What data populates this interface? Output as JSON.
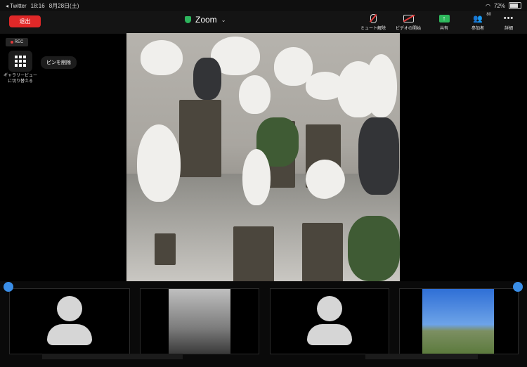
{
  "status_bar": {
    "back_app": "◂ Twitter",
    "time": "18:16",
    "date": "8月28日(土)",
    "battery": "72%"
  },
  "toolbar": {
    "leave_label": "退出",
    "title": "Zoom",
    "mute_label": "ミュート解除",
    "video_label": "ビデオの開始",
    "share_label": "共有",
    "participants_label": "参加者",
    "participants_count": "80",
    "more_label": "詳細"
  },
  "overlay": {
    "rec_label": "REC",
    "gallery_label": "ギャラリービューに切り替える",
    "unpin_label": "ピンを削除"
  },
  "icons": {
    "shield": "shield-icon",
    "mic_off": "mic-off-icon",
    "video_off": "video-off-icon",
    "share": "share-screen-icon",
    "participants": "participants-icon",
    "more": "more-dots-icon",
    "gallery": "grid-icon",
    "avatar": "avatar-icon"
  },
  "colors": {
    "leave": "#e02828",
    "share": "#2eb85c",
    "shield": "#2db55d",
    "rec_dot": "#e23b3b",
    "pin": "#3a8ee8"
  }
}
